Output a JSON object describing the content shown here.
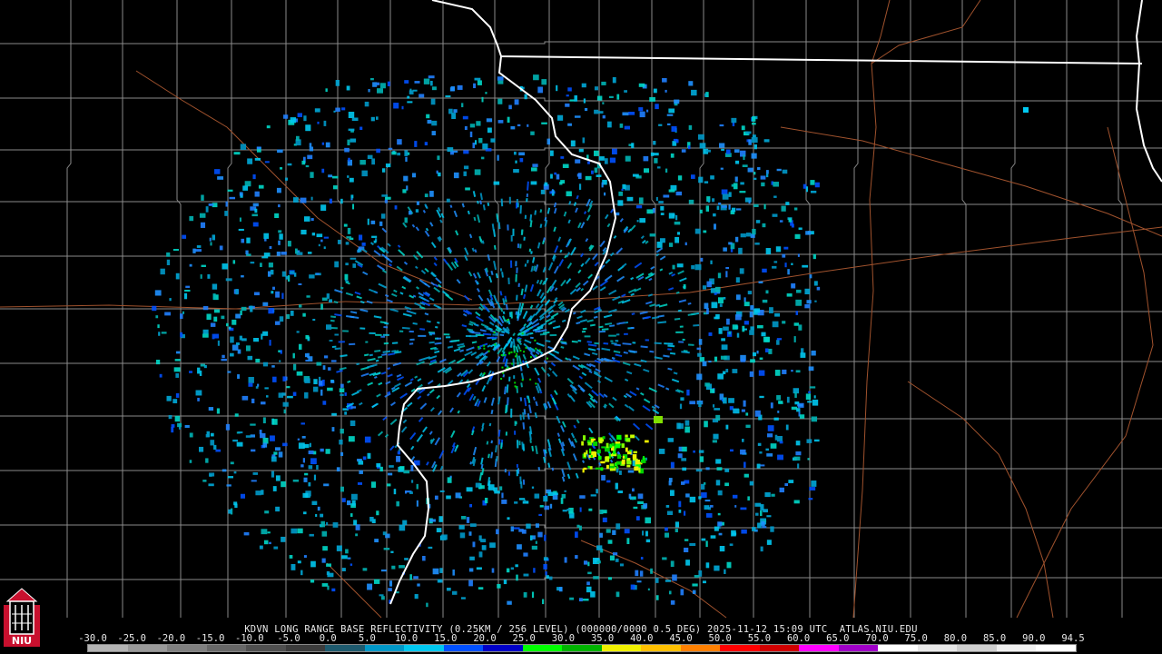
{
  "product": {
    "title": "KDVN LONG RANGE BASE REFLECTIVITY (0.25KM / 256 LEVEL) (000000/0000 0.5 DEG) 2025-11-12 15:09 UTC  ATLAS.NIU.EDU",
    "station": "KDVN",
    "timestamp": "2025-11-12 15:09 UTC",
    "source": "ATLAS.NIU.EDU"
  },
  "color_scale": {
    "labels": [
      "-30.0",
      "-25.0",
      "-20.0",
      "-15.0",
      "-10.0",
      "-5.0",
      "0.0",
      "5.0",
      "10.0",
      "15.0",
      "20.0",
      "25.0",
      "30.0",
      "35.0",
      "40.0",
      "45.0",
      "50.0",
      "55.0",
      "60.0",
      "65.0",
      "70.0",
      "75.0",
      "80.0",
      "85.0",
      "90.0",
      "94.5"
    ],
    "colors": [
      "#b4b4b4",
      "#9a9a9a",
      "#808080",
      "#686868",
      "#505050",
      "#3c3c3c",
      "#1e5a6e",
      "#0098c8",
      "#00c8f0",
      "#0050ff",
      "#0000c8",
      "#00ff00",
      "#00b400",
      "#f0f000",
      "#ffc000",
      "#ff8000",
      "#ff0000",
      "#d00000",
      "#ff00ff",
      "#a000c8",
      "#ffffff",
      "#e8e8e8",
      "#d0d0d0",
      "#f0f0f0",
      "#ffffff"
    ]
  },
  "logo": {
    "text": "NIU",
    "colors": {
      "red": "#c8102e",
      "white": "#ffffff"
    }
  },
  "map_colors": {
    "state_line": "#ffffff",
    "county_line": "#8a8a8a",
    "highway": "#a0522d"
  }
}
